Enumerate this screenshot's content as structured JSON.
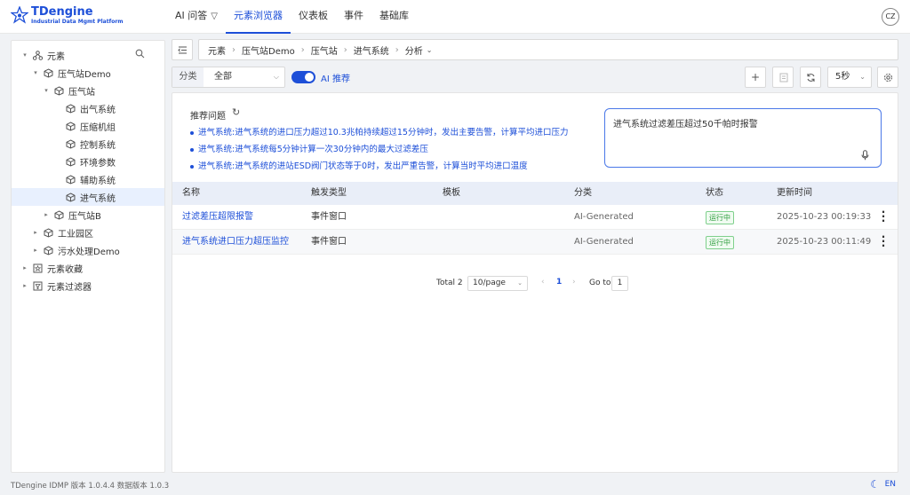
{
  "logo": {
    "title": "TDengine",
    "subtitle": "Industrial Data Mgmt Platform"
  },
  "nav": [
    {
      "label": "AI 问答",
      "icon": "ai-sparkle-icon",
      "active": false
    },
    {
      "label": "元素浏览器",
      "active": true
    },
    {
      "label": "仪表板",
      "active": false
    },
    {
      "label": "事件",
      "active": false
    },
    {
      "label": "基础库",
      "active": false
    }
  ],
  "user": {
    "initials": "CZ"
  },
  "tree": {
    "root": "元素",
    "nodes": [
      {
        "label": "压气站Demo"
      },
      {
        "label": "压气站"
      },
      {
        "label": "出气系统"
      },
      {
        "label": "压缩机组"
      },
      {
        "label": "控制系统"
      },
      {
        "label": "环境参数"
      },
      {
        "label": "辅助系统"
      },
      {
        "label": "进气系统",
        "selected": true
      },
      {
        "label": "压气站B"
      },
      {
        "label": "工业园区"
      },
      {
        "label": "污水处理Demo"
      }
    ],
    "favorites": "元素收藏",
    "filters": "元素过滤器"
  },
  "breadcrumb": [
    "元素",
    "压气站Demo",
    "压气站",
    "进气系统",
    "分析"
  ],
  "filter": {
    "label": "分类",
    "value": "全部"
  },
  "ai_toggle": {
    "label": "AI 推荐",
    "on": true
  },
  "interval": {
    "value": "5秒"
  },
  "recommend": {
    "title": "推荐问题",
    "items": [
      "进气系统:进气系统的进口压力超过10.3兆帕持续超过15分钟时，发出主要告警，计算平均进口压力",
      "进气系统:进气系统每5分钟计算一次30分钟内的最大过滤差压",
      "进气系统:进气系统的进站ESD阀门状态等于0时，发出严重告警，计算当时平均进口温度"
    ],
    "input_value": "进气系统过滤差压超过50千帕时报警"
  },
  "table": {
    "headers": [
      "名称",
      "触发类型",
      "模板",
      "分类",
      "状态",
      "更新时间"
    ],
    "rows": [
      {
        "name": "过滤差压超限报警",
        "trigger": "事件窗口",
        "template": "",
        "category": "AI-Generated",
        "status": "运行中",
        "updated": "2025-10-23 00:19:33"
      },
      {
        "name": "进气系统进口压力超压监控",
        "trigger": "事件窗口",
        "template": "",
        "category": "AI-Generated",
        "status": "运行中",
        "updated": "2025-10-23 00:11:49"
      }
    ]
  },
  "pager": {
    "total": "Total 2",
    "page_size": "10/page",
    "page": "1",
    "goto_label": "Go to",
    "goto_value": "1"
  },
  "footer": {
    "version": "TDengine IDMP 版本 1.0.4.4 数据版本 1.0.3",
    "lang": "EN"
  },
  "colors": {
    "accent": "#1d4fd8",
    "status_green": "#2e9e3e"
  }
}
